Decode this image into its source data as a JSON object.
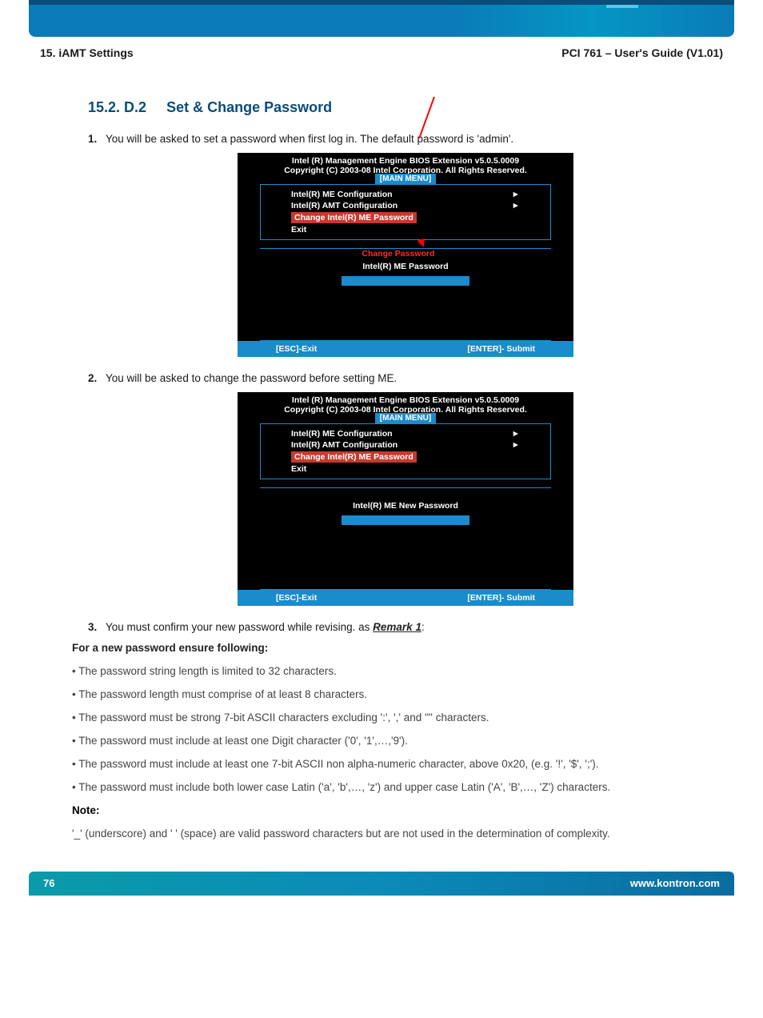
{
  "header": {
    "left": "15. iAMT Settings",
    "right": "PCI 761 – User's Guide (V1.01)"
  },
  "section": {
    "number": "15.2. D.2",
    "title": "Set & Change Password"
  },
  "steps": {
    "s1": {
      "num": "1.",
      "text": "You will be asked to set a password when first log in. The default password is 'admin'."
    },
    "s2": {
      "num": "2.",
      "text": "You will be asked to change the password before setting ME."
    },
    "s3": {
      "num": "3.",
      "text_a": "You must confirm your new password while revising. as ",
      "remark": "Remark 1",
      "text_b": ":"
    }
  },
  "bios1": {
    "line1": "Intel (R) Management Engine BIOS Extension v5.0.5.0009",
    "line2": "Copyright (C) 2003-08 Intel Corporation. All Rights Reserved.",
    "menu_label": "[MAIN MENU]",
    "menu": {
      "item1": "Intel(R) ME Configuration",
      "item2": "Intel(R) AMT Configuration",
      "item3": "Change Intel(R) ME Password",
      "item4": "Exit"
    },
    "overlay": "Change Password",
    "prompt": "Intel(R) ME Password",
    "foot_left": "[ESC]-Exit",
    "foot_right": "[ENTER]- Submit"
  },
  "bios2": {
    "line1": "Intel (R) Management Engine BIOS Extension v5.0.5.0009",
    "line2": "Copyright (C) 2003-08 Intel Corporation. All Rights Reserved.",
    "menu_label": "[MAIN MENU]",
    "menu": {
      "item1": "Intel(R) ME Configuration",
      "item2": "Intel(R) AMT Configuration",
      "item3": "Change Intel(R) ME Password",
      "item4": "Exit"
    },
    "prompt": "Intel(R) ME New Password",
    "foot_left": "[ESC]-Exit",
    "foot_right": "[ENTER]- Submit"
  },
  "remarks": {
    "intro": "For a new password ensure following:",
    "b1": "• The password string length is limited to 32 characters.",
    "b2": "• The password length must comprise of at least 8 characters.",
    "b3": "• The password must be strong 7-bit ASCII characters excluding ':', ',' and '\"' characters.",
    "b4": "• The password must include at least one Digit character ('0', '1',…,'9').",
    "b5": "• The password must include at least one 7-bit ASCII non alpha-numeric character, above 0x20, (e.g. '!', '$', ';').",
    "b6": "• The password must include both lower case Latin ('a', 'b',…, 'z') and upper case Latin ('A', 'B',…, 'Z') characters.",
    "note_label": "Note:",
    "note_text": "'_' (underscore) and ' ' (space) are valid password characters but are not used in the determination of complexity."
  },
  "footer": {
    "page": "76",
    "url": "www.kontron.com"
  }
}
